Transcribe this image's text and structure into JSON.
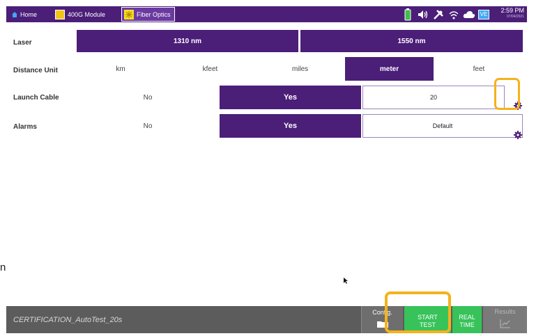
{
  "topbar": {
    "home_label": "Home",
    "module_label": "400G Module",
    "fiber_label": "Fiber Optics",
    "time": "2:59 PM",
    "date": "07/04/2021",
    "vnc_label": "VE",
    "bg_color": "#4b1e78"
  },
  "laser": {
    "label": "Laser",
    "options": [
      "1310 nm",
      "1550 nm"
    ],
    "selected": "1550 nm"
  },
  "distance_unit": {
    "label": "Distance Unit",
    "options": [
      "km",
      "kfeet",
      "miles",
      "meter",
      "feet"
    ],
    "selected": "meter"
  },
  "launch_cable": {
    "label": "Launch Cable",
    "no_label": "No",
    "yes_label": "Yes",
    "selected": "Yes",
    "value": "20"
  },
  "alarms": {
    "label": "Alarms",
    "no_label": "No",
    "yes_label": "Yes",
    "selected": "Yes",
    "value": "Default"
  },
  "bottombar": {
    "test_name": "CERTIFICATION_AutoTest_20s",
    "config_label": "Config.",
    "start_line1": "START",
    "start_line2": "TEST",
    "real_line1": "REAL",
    "real_line2": "TIME",
    "results_label": "Results"
  },
  "side_text": "n",
  "accent_color": "#4b1e78",
  "start_color": "#37c25a",
  "highlight_color": "#f5b21b",
  "icons": [
    "home-icon",
    "battery-icon",
    "speaker-icon",
    "tools-icon",
    "wifi-icon",
    "cloud-icon",
    "gear-icon",
    "folder-icon",
    "graph-icon"
  ]
}
